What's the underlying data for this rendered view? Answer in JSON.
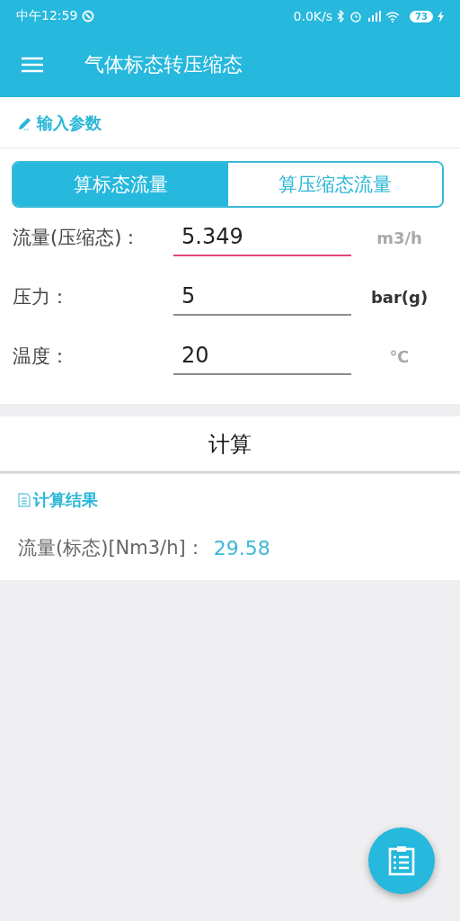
{
  "status_bar": {
    "time": "中午12:59",
    "speed": "0.0K/s",
    "battery": "73"
  },
  "app_bar": {
    "title": "气体标态转压缩态"
  },
  "input_section": {
    "title": "输入参数"
  },
  "tabs": [
    {
      "label": "算标态流量",
      "selected": true
    },
    {
      "label": "算压缩态流量",
      "selected": false
    }
  ],
  "fields": [
    {
      "label": "流量(压缩态)：",
      "value": "5.349",
      "unit": "m3/h",
      "focused": true,
      "unit_muted": true
    },
    {
      "label": "压力：",
      "value": "5",
      "unit": "bar(g)",
      "focused": false,
      "unit_muted": false
    },
    {
      "label": "温度：",
      "value": "20",
      "unit": "℃",
      "focused": false,
      "unit_muted": true
    }
  ],
  "calculate_button": "计算",
  "result_section": {
    "title": "计算结果",
    "label": "流量(标态)[Nm3/h]：",
    "value": "29.58"
  }
}
